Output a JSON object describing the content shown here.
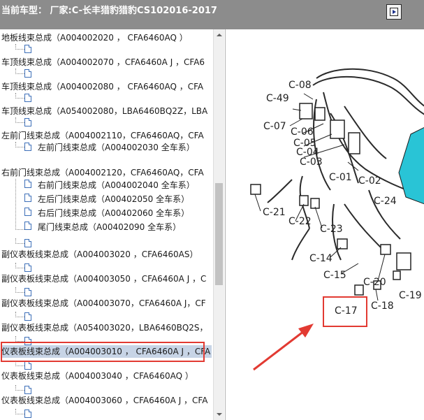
{
  "window": {
    "title": "当前车型： 厂家:C-长丰猎豹猎豹CS102016-2017"
  },
  "tree": {
    "rows": [
      {
        "text": "地板线束总成（A004002020 ， CFA6460AQ ）"
      },
      {
        "text": ""
      },
      {
        "text": "车顶线束总成（A004002070 ，CFA6460A J ，CFA6"
      },
      {
        "text": ""
      },
      {
        "text": "车顶线束总成（A004002080 ， CFA6460AQ ，CFA"
      },
      {
        "text": ""
      },
      {
        "text": "车顶线束总成（A054002080，LBA6460BQ2Z，LBA"
      },
      {
        "text": ""
      },
      {
        "text": "左前门线束总成（A004002110，CFA6460AQ，CFA"
      },
      {
        "text": "左前门线束总成（A004002030 全车系）"
      },
      {
        "text": "右前门线束总成（A004002120，CFA6460AQ，CFA"
      },
      {
        "text": "右前门线束总成（A004002040 全车系）"
      },
      {
        "text": "左后门线束总成（A00402050 全车系）"
      },
      {
        "text": "右后门线束总成（A00402060 全车系）"
      },
      {
        "text": "尾门线束总成（A00402090 全车系）"
      },
      {
        "text": ""
      },
      {
        "text": "副仪表板线束总成（A004003020 ，CFA6460AS）"
      },
      {
        "text": ""
      },
      {
        "text": "副仪表板线束总成（A004003050 ，CFA6460A J ，C"
      },
      {
        "text": ""
      },
      {
        "text": "副仪表板线束总成（A004003070，CFA6460A J，CF"
      },
      {
        "text": ""
      },
      {
        "text": "副仪表板线束总成（A054003020，LBA6460BQ2S，"
      },
      {
        "text": ""
      },
      {
        "text": "仪表板线束总成（A004003010 ， CFA6460A J ，CFA"
      },
      {
        "text": ""
      },
      {
        "text": "仪表板线束总成（A004003040 ，CFA6460AQ ）"
      },
      {
        "text": ""
      },
      {
        "text": "仪表板线束总成（A004003060 ，CFA6460A J ，CFA"
      },
      {
        "text": ""
      }
    ]
  },
  "diagram": {
    "labels": [
      "C-08",
      "C-49",
      "C-07",
      "C-06",
      "C-05",
      "C-04",
      "C-03",
      "C-01",
      "C-02",
      "C-24",
      "C-21",
      "C-22",
      "C-23",
      "C-14",
      "C-15",
      "C-20",
      "C-19",
      "C-18",
      "C-17"
    ]
  },
  "colors": {
    "highlight_red": "#e23a32",
    "selection_blue": "#c7d4e6",
    "accent_cyan": "#29c4d6"
  }
}
